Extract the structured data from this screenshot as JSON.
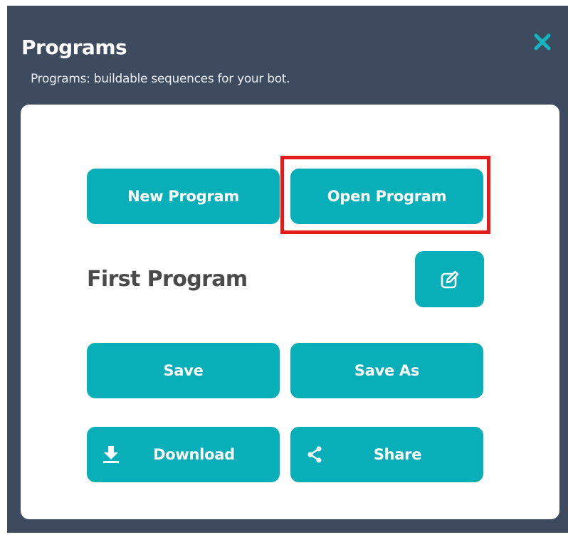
{
  "panel": {
    "title": "Programs",
    "subtitle": "Programs: buildable sequences for your bot."
  },
  "buttons": {
    "new_program": "New Program",
    "open_program": "Open Program",
    "save": "Save",
    "save_as": "Save As",
    "download": "Download",
    "share": "Share"
  },
  "current_program": {
    "name": "First Program"
  },
  "icons": {
    "close": "close-icon",
    "edit": "edit-icon",
    "download": "download-icon",
    "share": "share-icon"
  },
  "colors": {
    "panel_background": "#3e4a5e",
    "card_background": "#ffffff",
    "accent": "#08aeb8",
    "highlight": "#e31b1b",
    "program_name_text": "#4a4a4a"
  }
}
